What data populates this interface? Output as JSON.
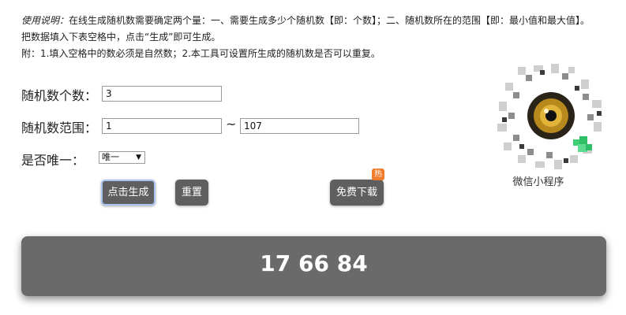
{
  "instructions": {
    "lead": "使用说明：",
    "body": "在线生成随机数需要确定两个量：一、需要生成多少个随机数【即：个数】；二、随机数所在的范围【即：最小值和最大值】。把数据填入下表空格中，点击“生成”即可生成。",
    "note": "附：1.填入空格中的数必须是自然数；2.本工具可设置所生成的随机数是否可以重复。"
  },
  "form": {
    "count_label": "随机数个数：",
    "count_value": "3",
    "range_label": "随机数范围：",
    "range_min": "1",
    "range_separator": "~",
    "range_max": "107",
    "unique_label": "是否唯一：",
    "unique_selected": "唯一",
    "unique_chevron": "▼"
  },
  "buttons": {
    "generate": "点击生成",
    "reset": "重置",
    "download": "免费下载",
    "hot_badge": "热"
  },
  "qr": {
    "caption": "微信小程序"
  },
  "result": {
    "numbers": "17 66 84"
  },
  "colors": {
    "button_bg": "#5f5f5f",
    "panel_bg": "#6a6a6a",
    "badge": "#f07b2b"
  }
}
